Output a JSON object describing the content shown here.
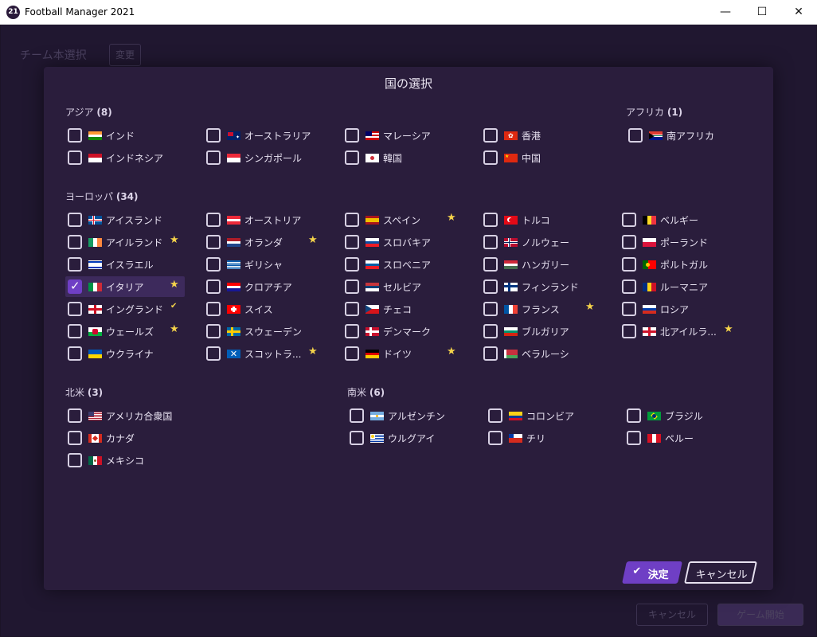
{
  "window": {
    "title": "Football Manager 2021",
    "icon_text": "21",
    "minimize": "—",
    "maximize": "☐",
    "close": "✕"
  },
  "background": {
    "heading": "チーム本選択",
    "chip": "変更",
    "btn_cancel": "キャンセル",
    "btn_start": "ゲーム開始"
  },
  "modal": {
    "title": "国の選択",
    "confirm_label": "決定",
    "cancel_label": "キャンセル"
  },
  "regions": {
    "asia": {
      "name": "アジア",
      "count": "(8)"
    },
    "africa": {
      "name": "アフリカ",
      "count": "(1)"
    },
    "europe": {
      "name": "ヨーロッパ",
      "count": "(34)"
    },
    "north_america": {
      "name": "北米",
      "count": "(3)"
    },
    "south_america": {
      "name": "南米",
      "count": "(6)"
    }
  },
  "countries": [
    {
      "name": "インド",
      "flag": "india",
      "checked": false,
      "badge": ""
    },
    {
      "name": "インドネシア",
      "flag": "indonesia",
      "checked": false,
      "badge": ""
    },
    {
      "name": "オーストラリア",
      "flag": "australia",
      "checked": false,
      "badge": ""
    },
    {
      "name": "シンガポール",
      "flag": "singapore",
      "checked": false,
      "badge": ""
    },
    {
      "name": "マレーシア",
      "flag": "malaysia",
      "checked": false,
      "badge": ""
    },
    {
      "name": "韓国",
      "flag": "korea",
      "checked": false,
      "badge": ""
    },
    {
      "name": "香港",
      "flag": "hongkong",
      "checked": false,
      "badge": ""
    },
    {
      "name": "中国",
      "flag": "china",
      "checked": false,
      "badge": ""
    },
    {
      "name": "南アフリカ",
      "flag": "southafrica",
      "checked": false,
      "badge": ""
    },
    {
      "name": "アイスランド",
      "flag": "iceland",
      "checked": false,
      "badge": ""
    },
    {
      "name": "アイルランド",
      "flag": "ireland",
      "checked": false,
      "badge": "star"
    },
    {
      "name": "イスラエル",
      "flag": "israel",
      "checked": false,
      "badge": ""
    },
    {
      "name": "イタリア",
      "flag": "italy",
      "checked": true,
      "badge": "star"
    },
    {
      "name": "イングランド",
      "flag": "england",
      "checked": false,
      "badge": "tick"
    },
    {
      "name": "ウェールズ",
      "flag": "wales",
      "checked": false,
      "badge": "star"
    },
    {
      "name": "ウクライナ",
      "flag": "ukraine",
      "checked": false,
      "badge": ""
    },
    {
      "name": "オーストリア",
      "flag": "austria",
      "checked": false,
      "badge": ""
    },
    {
      "name": "オランダ",
      "flag": "netherlands",
      "checked": false,
      "badge": "star"
    },
    {
      "name": "ギリシャ",
      "flag": "greece",
      "checked": false,
      "badge": ""
    },
    {
      "name": "クロアチア",
      "flag": "croatia",
      "checked": false,
      "badge": ""
    },
    {
      "name": "スイス",
      "flag": "switzerland",
      "checked": false,
      "badge": ""
    },
    {
      "name": "スウェーデン",
      "flag": "sweden",
      "checked": false,
      "badge": ""
    },
    {
      "name": "スコットラ...",
      "flag": "scotland",
      "checked": false,
      "badge": "star"
    },
    {
      "name": "スペイン",
      "flag": "spain",
      "checked": false,
      "badge": "star"
    },
    {
      "name": "スロバキア",
      "flag": "slovakia",
      "checked": false,
      "badge": ""
    },
    {
      "name": "スロベニア",
      "flag": "slovenia",
      "checked": false,
      "badge": ""
    },
    {
      "name": "セルビア",
      "flag": "serbia",
      "checked": false,
      "badge": ""
    },
    {
      "name": "チェコ",
      "flag": "czech",
      "checked": false,
      "badge": ""
    },
    {
      "name": "デンマーク",
      "flag": "denmark",
      "checked": false,
      "badge": ""
    },
    {
      "name": "ドイツ",
      "flag": "germany",
      "checked": false,
      "badge": "star"
    },
    {
      "name": "トルコ",
      "flag": "turkey",
      "checked": false,
      "badge": ""
    },
    {
      "name": "ノルウェー",
      "flag": "norway",
      "checked": false,
      "badge": ""
    },
    {
      "name": "ハンガリー",
      "flag": "hungary",
      "checked": false,
      "badge": ""
    },
    {
      "name": "フィンランド",
      "flag": "finland",
      "checked": false,
      "badge": ""
    },
    {
      "name": "フランス",
      "flag": "france",
      "checked": false,
      "badge": "star"
    },
    {
      "name": "ブルガリア",
      "flag": "bulgaria",
      "checked": false,
      "badge": ""
    },
    {
      "name": "ベラルーシ",
      "flag": "belarus",
      "checked": false,
      "badge": ""
    },
    {
      "name": "ベルギー",
      "flag": "belgium",
      "checked": false,
      "badge": ""
    },
    {
      "name": "ポーランド",
      "flag": "poland",
      "checked": false,
      "badge": ""
    },
    {
      "name": "ポルトガル",
      "flag": "portugal",
      "checked": false,
      "badge": ""
    },
    {
      "name": "ルーマニア",
      "flag": "romania",
      "checked": false,
      "badge": ""
    },
    {
      "name": "ロシア",
      "flag": "russia",
      "checked": false,
      "badge": ""
    },
    {
      "name": "北アイルラ...",
      "flag": "northernireland",
      "checked": false,
      "badge": "star"
    },
    {
      "name": "アメリカ合衆国",
      "flag": "usa",
      "checked": false,
      "badge": ""
    },
    {
      "name": "カナダ",
      "flag": "canada",
      "checked": false,
      "badge": ""
    },
    {
      "name": "メキシコ",
      "flag": "mexico",
      "checked": false,
      "badge": ""
    },
    {
      "name": "アルゼンチン",
      "flag": "argentina",
      "checked": false,
      "badge": ""
    },
    {
      "name": "ウルグアイ",
      "flag": "uruguay",
      "checked": false,
      "badge": ""
    },
    {
      "name": "コロンビア",
      "flag": "colombia",
      "checked": false,
      "badge": ""
    },
    {
      "name": "チリ",
      "flag": "chile",
      "checked": false,
      "badge": ""
    },
    {
      "name": "ブラジル",
      "flag": "brazil",
      "checked": false,
      "badge": ""
    },
    {
      "name": "ペルー",
      "flag": "peru",
      "checked": false,
      "badge": ""
    }
  ],
  "colors": {
    "accent": "#6f3fc5",
    "modal_bg": "#2a1d3c",
    "star": "#f5d34a"
  }
}
